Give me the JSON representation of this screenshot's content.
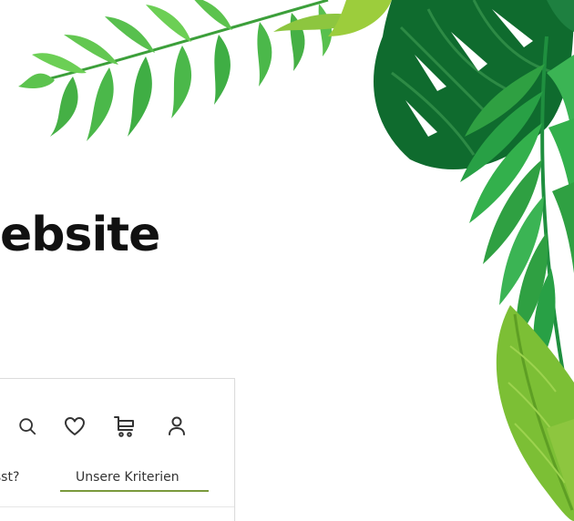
{
  "hero": {
    "title_fragment": "ebsite"
  },
  "preview": {
    "toolbar_icons": [
      "search-icon",
      "heart-icon",
      "cart-icon",
      "user-icon"
    ],
    "nav": {
      "cut_item": "usst?",
      "active_item": "Unsere Kriterien"
    },
    "colors": {
      "accent_underline": "#7a9a3c",
      "icon_stroke": "#333333"
    }
  },
  "colors": {
    "leaf_light": "#5cc34e",
    "leaf_mid": "#2fa042",
    "leaf_dark": "#0f6b2e",
    "leaf_lime": "#8dc63f"
  }
}
